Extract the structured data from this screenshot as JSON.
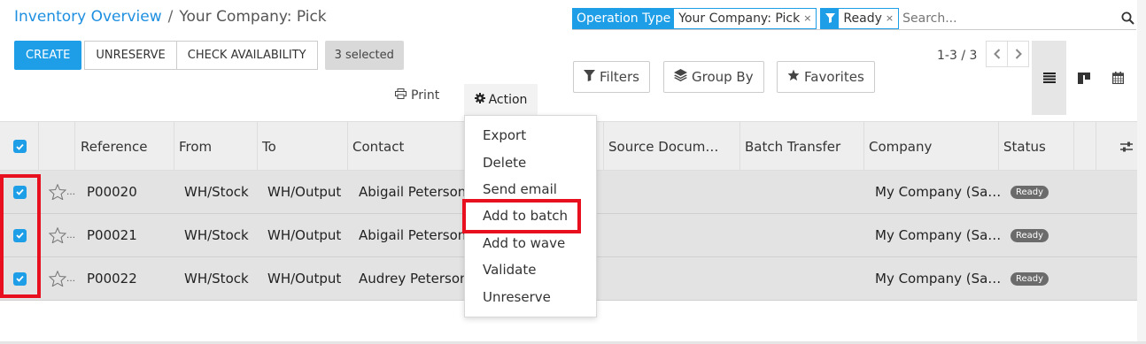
{
  "breadcrumb": {
    "parent": "Inventory Overview",
    "separator": "/",
    "current": "Your Company: Pick"
  },
  "toolbar": {
    "create_label": "CREATE",
    "unreserve_label": "UNRESERVE",
    "check_availability_label": "CHECK AVAILABILITY",
    "selected_label": "3 selected",
    "print_label": "Print",
    "action_label": "Action"
  },
  "search": {
    "facets": [
      {
        "label": "Operation Type",
        "value": "Your Company: Pick"
      },
      {
        "icon": "filter-icon",
        "value": "Ready"
      }
    ],
    "placeholder": "Search...",
    "close_glyph": "×"
  },
  "filters": {
    "filters_label": "Filters",
    "group_by_label": "Group By",
    "favorites_label": "Favorites"
  },
  "pager": {
    "text": "1-3 / 3"
  },
  "views": [
    "list-view-icon",
    "kanban-view-icon",
    "calendar-view-icon"
  ],
  "table": {
    "columns": [
      "Reference",
      "From",
      "To",
      "Contact",
      "Source Docum…",
      "Batch Transfer",
      "Company",
      "Status"
    ],
    "rows": [
      {
        "reference": "P00020",
        "from": "WH/Stock",
        "to": "WH/Output",
        "contact": "Abigail Peterson",
        "company": "My Company (Sa…",
        "status": "Ready"
      },
      {
        "reference": "P00021",
        "from": "WH/Stock",
        "to": "WH/Output",
        "contact": "Abigail Peterson",
        "company": "My Company (Sa…",
        "status": "Ready"
      },
      {
        "reference": "P00022",
        "from": "WH/Stock",
        "to": "WH/Output",
        "contact": "Audrey Peterson",
        "company": "My Company (Sa…",
        "status": "Ready"
      }
    ]
  },
  "action_menu": {
    "items": [
      "Export",
      "Delete",
      "Send email",
      "Add to batch",
      "Add to wave",
      "Validate",
      "Unreserve"
    ],
    "highlighted": "Add to batch"
  },
  "colors": {
    "primary": "#1f9ee8",
    "highlight": "#e8101e",
    "row_bg": "#e3e3e3"
  }
}
